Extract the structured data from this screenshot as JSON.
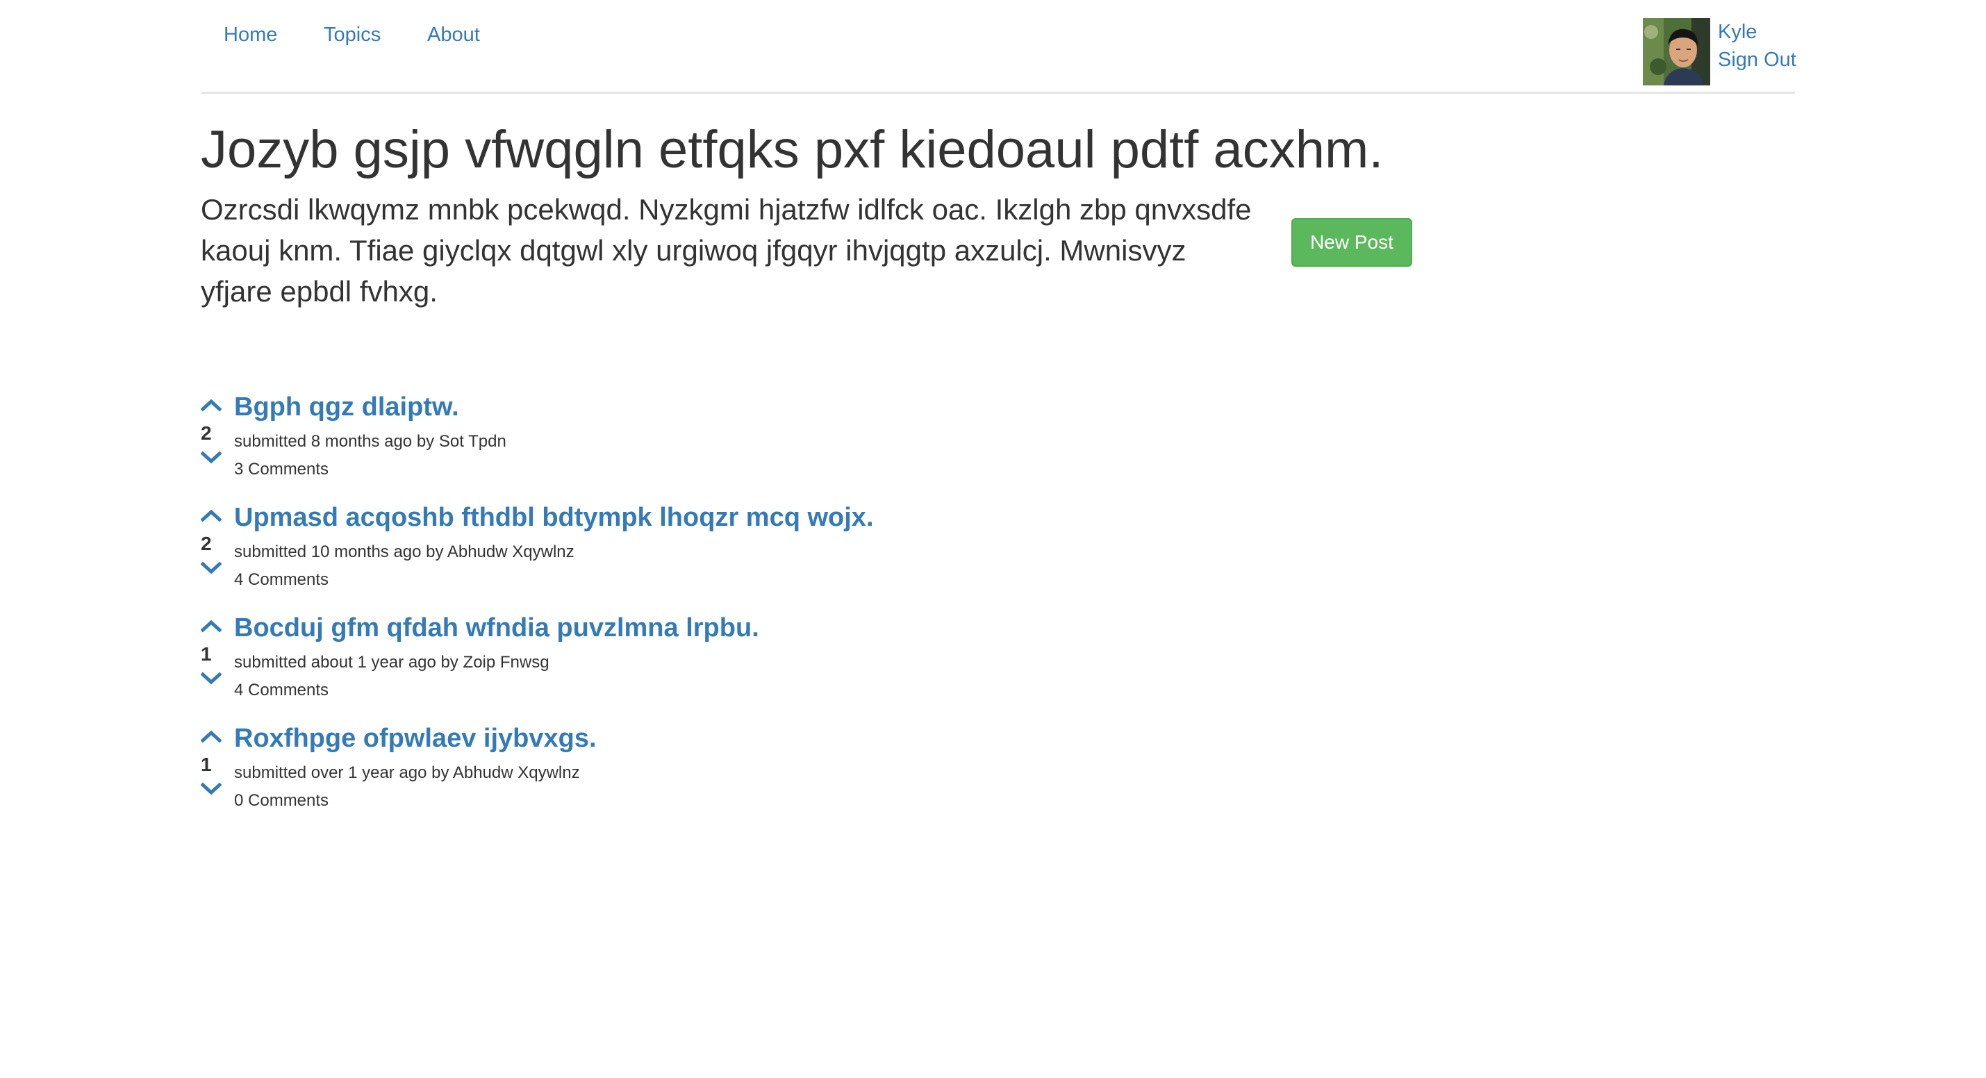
{
  "nav": {
    "items": [
      {
        "label": "Home"
      },
      {
        "label": "Topics"
      },
      {
        "label": "About"
      }
    ]
  },
  "user": {
    "name": "Kyle",
    "sign_out_label": "Sign Out"
  },
  "header": {
    "title": "Jozyb gsjp vfwqgln etfqks pxf kiedoaul pdtf acxhm.",
    "description": "Ozrcsdi lkwqymz mnbk pcekwqd. Nyzkgmi hjatzfw idlfck oac. Ikzlgh zbp qnvxsdfe kaouj knm. Tfiae giyclqx dqtgwl xly urgiwoq jfgqyr ihvjqgtp axzulcj. Mwnisvyz yfjare epbdl fvhxg.",
    "new_post_label": "New Post"
  },
  "posts": [
    {
      "votes": "2",
      "title": "Bgph qgz dlaiptw.",
      "meta": "submitted 8 months ago by Sot Tpdn",
      "comments": "3 Comments"
    },
    {
      "votes": "2",
      "title": "Upmasd acqoshb fthdbl bdtympk lhoqzr mcq wojx.",
      "meta": "submitted 10 months ago by Abhudw Xqywlnz",
      "comments": "4 Comments"
    },
    {
      "votes": "1",
      "title": "Bocduj gfm qfdah wfndia puvzlmna lrpbu.",
      "meta": "submitted about 1 year ago by Zoip Fnwsg",
      "comments": "4 Comments"
    },
    {
      "votes": "1",
      "title": "Roxfhpge ofpwlaev ijybvxgs.",
      "meta": "submitted over 1 year ago by Abhudw Xqywlnz",
      "comments": "0 Comments"
    }
  ],
  "colors": {
    "link": "#337ab7",
    "success": "#5cb85c",
    "text": "#333333",
    "divider": "#e5e5e5"
  },
  "icons": {
    "vote_up": "chevron-up-icon",
    "vote_down": "chevron-down-icon"
  }
}
